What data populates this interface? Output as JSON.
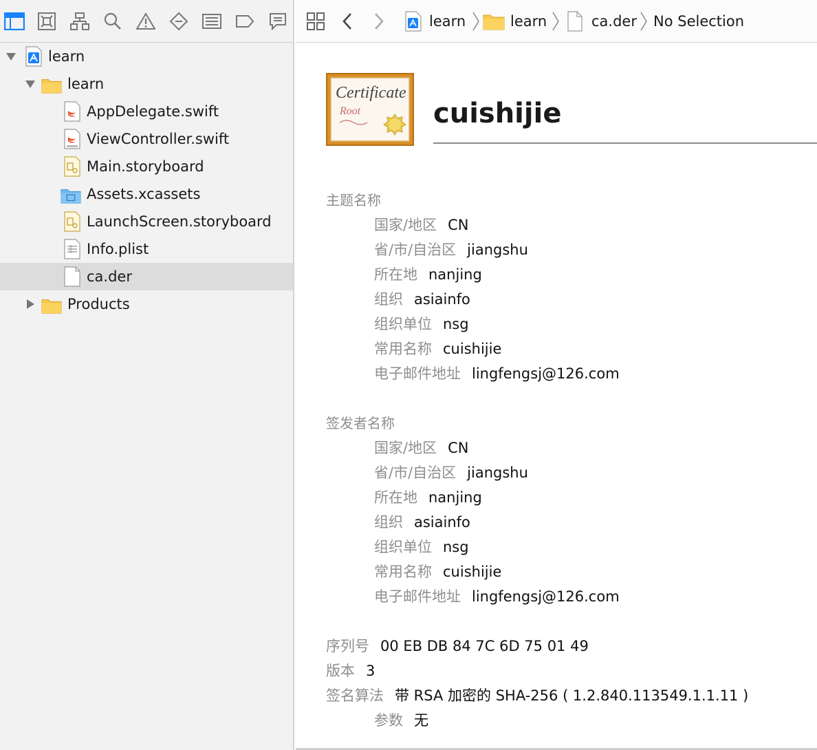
{
  "navigator": {
    "toolbar_icons": [
      "project-navigator-icon",
      "source-control-icon",
      "symbol-navigator-icon",
      "find-navigator-icon",
      "issue-navigator-icon",
      "test-navigator-icon",
      "debug-navigator-icon",
      "breakpoint-navigator-icon",
      "report-navigator-icon"
    ],
    "tree": [
      {
        "label": "learn",
        "kind": "project",
        "level": 0,
        "expanded": true
      },
      {
        "label": "learn",
        "kind": "folder",
        "level": 1,
        "expanded": true
      },
      {
        "label": "AppDelegate.swift",
        "kind": "swift",
        "level": 2
      },
      {
        "label": "ViewController.swift",
        "kind": "swift",
        "level": 2
      },
      {
        "label": "Main.storyboard",
        "kind": "storyboard",
        "level": 2
      },
      {
        "label": "Assets.xcassets",
        "kind": "assets",
        "level": 2
      },
      {
        "label": "LaunchScreen.storyboard",
        "kind": "storyboard",
        "level": 2
      },
      {
        "label": "Info.plist",
        "kind": "plist",
        "level": 2
      },
      {
        "label": "ca.der",
        "kind": "file",
        "level": 2,
        "selected": true
      },
      {
        "label": "Products",
        "kind": "folder",
        "level": 1,
        "expanded": false
      }
    ]
  },
  "jump_bar": {
    "crumbs": [
      "learn",
      "learn",
      "ca.der",
      "No Selection"
    ]
  },
  "certificate": {
    "badge_title": "Certificate",
    "badge_subtitle": "Root",
    "title": "cuishijie",
    "subject": {
      "heading": "主题名称",
      "fields": [
        {
          "label": "国家/地区",
          "value": "CN"
        },
        {
          "label": "省/市/自治区",
          "value": "jiangshu"
        },
        {
          "label": "所在地",
          "value": "nanjing"
        },
        {
          "label": "组织",
          "value": "asiainfo"
        },
        {
          "label": "组织单位",
          "value": "nsg"
        },
        {
          "label": "常用名称",
          "value": "cuishijie"
        },
        {
          "label": "电子邮件地址",
          "value": "lingfengsj@126.com"
        }
      ]
    },
    "issuer": {
      "heading": "签发者名称",
      "fields": [
        {
          "label": "国家/地区",
          "value": "CN"
        },
        {
          "label": "省/市/自治区",
          "value": "jiangshu"
        },
        {
          "label": "所在地",
          "value": "nanjing"
        },
        {
          "label": "组织",
          "value": "asiainfo"
        },
        {
          "label": "组织单位",
          "value": "nsg"
        },
        {
          "label": "常用名称",
          "value": "cuishijie"
        },
        {
          "label": "电子邮件地址",
          "value": "lingfengsj@126.com"
        }
      ]
    },
    "serial": {
      "label": "序列号",
      "value": "00 EB DB 84 7C 6D 75 01 49"
    },
    "version": {
      "label": "版本",
      "value": "3"
    },
    "sig_alg": {
      "label": "签名算法",
      "value": "带 RSA 加密的 SHA-256 ( 1.2.840.113549.1.1.11 )"
    },
    "params": {
      "label": "参数",
      "value": "无"
    }
  },
  "colors": {
    "accent": "#1a82fb",
    "folder": "#f7c74a",
    "selection": "#dcdcdc"
  }
}
